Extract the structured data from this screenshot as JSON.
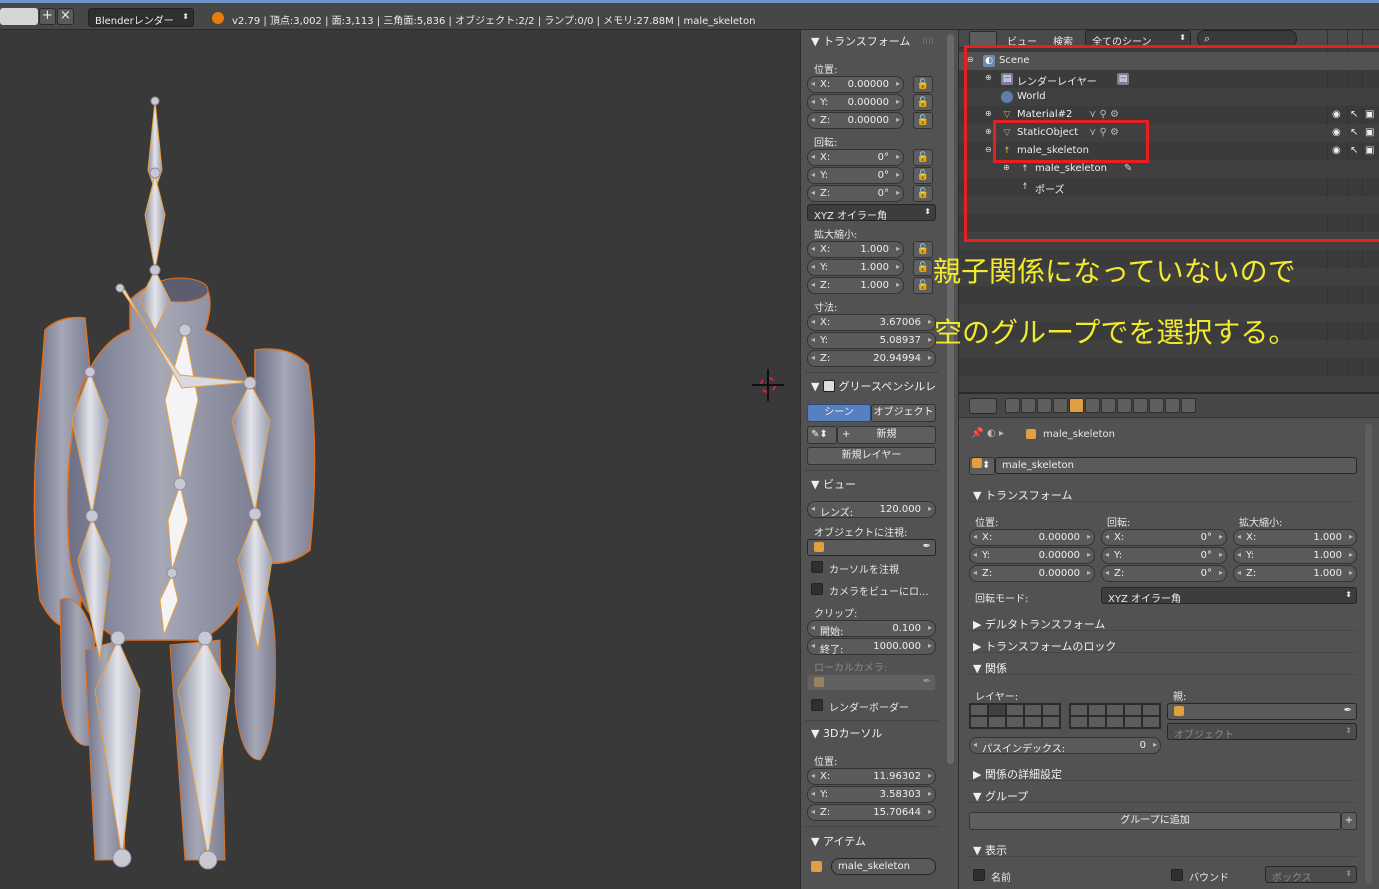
{
  "topbar": {
    "render_engine": "Blenderレンダー",
    "info": "v2.79 | 頂点:3,002 | 面:3,113 | 三角面:5,836 | オブジェクト:2/2 | ランプ:0/0 | メモリ:27.88M | male_skeleton"
  },
  "npanel": {
    "transform": {
      "title": "トランスフォーム",
      "location_label": "位置:",
      "location": [
        {
          "k": "X:",
          "v": "0.00000"
        },
        {
          "k": "Y:",
          "v": "0.00000"
        },
        {
          "k": "Z:",
          "v": "0.00000"
        }
      ],
      "rotation_label": "回転:",
      "rotation": [
        {
          "k": "X:",
          "v": "0°"
        },
        {
          "k": "Y:",
          "v": "0°"
        },
        {
          "k": "Z:",
          "v": "0°"
        }
      ],
      "rotation_mode": "XYZ オイラー角",
      "scale_label": "拡大縮小:",
      "scale": [
        {
          "k": "X:",
          "v": "1.000"
        },
        {
          "k": "Y:",
          "v": "1.000"
        },
        {
          "k": "Z:",
          "v": "1.000"
        }
      ],
      "dimensions_label": "寸法:",
      "dimensions": [
        {
          "k": "X:",
          "v": "3.67006"
        },
        {
          "k": "Y:",
          "v": "5.08937"
        },
        {
          "k": "Z:",
          "v": "20.94994"
        }
      ]
    },
    "grease": {
      "title": "グリースペンシルレ",
      "scene_tab": "シーン",
      "object_tab": "オブジェクト",
      "new_label": "新規",
      "new_layer": "新規レイヤー"
    },
    "view": {
      "title": "ビュー",
      "lens_k": "レンズ:",
      "lens_v": "120.000",
      "lock_to_object": "オブジェクトに注視:",
      "lock_cursor": "カーソルを注視",
      "lock_camera": "カメラをビューにロ...",
      "clip_label": "クリップ:",
      "clip_start_k": "開始:",
      "clip_start_v": "0.100",
      "clip_end_k": "終了:",
      "clip_end_v": "1000.000",
      "local_camera": "ローカルカメラ:",
      "render_border": "レンダーボーダー"
    },
    "cursor": {
      "title": "3Dカーソル",
      "location_label": "位置:",
      "location": [
        {
          "k": "X:",
          "v": "11.96302"
        },
        {
          "k": "Y:",
          "v": "3.58303"
        },
        {
          "k": "Z:",
          "v": "15.70644"
        }
      ]
    },
    "item": {
      "title": "アイテム",
      "name": "male_skeleton"
    }
  },
  "outliner": {
    "header": {
      "view": "ビュー",
      "search": "検索",
      "scope": "全てのシーン"
    },
    "rows": [
      "Scene",
      "レンダーレイヤー",
      "World",
      "Material#2",
      "StaticObject",
      "male_skeleton",
      "male_skeleton",
      "ポーズ"
    ]
  },
  "annotation": {
    "line1": "親子関係になっていないので",
    "line2": "空のグループでを選択する。"
  },
  "props": {
    "breadcrumb": "male_skeleton",
    "object_name": "male_skeleton",
    "transform": {
      "title": "トランスフォーム",
      "loc_label": "位置:",
      "rot_label": "回転:",
      "scale_label": "拡大縮小:",
      "loc": [
        {
          "k": "X:",
          "v": "0.00000"
        },
        {
          "k": "Y:",
          "v": "0.00000"
        },
        {
          "k": "Z:",
          "v": "0.00000"
        }
      ],
      "rot": [
        {
          "k": "X:",
          "v": "0°"
        },
        {
          "k": "Y:",
          "v": "0°"
        },
        {
          "k": "Z:",
          "v": "0°"
        }
      ],
      "scale": [
        {
          "k": "X:",
          "v": "1.000"
        },
        {
          "k": "Y:",
          "v": "1.000"
        },
        {
          "k": "Z:",
          "v": "1.000"
        }
      ],
      "rotmode_label": "回転モード:",
      "rotmode": "XYZ オイラー角"
    },
    "delta": "デルタトランスフォーム",
    "lock": "トランスフォームのロック",
    "relations": {
      "title": "関係",
      "layer_label": "レイヤー:",
      "parent_label": "親:",
      "parent_type": "オブジェクト",
      "pass_k": "パスインデックス:",
      "pass_v": "0"
    },
    "relations_extra": "関係の詳細設定",
    "groups": {
      "title": "グループ",
      "add": "グループに追加"
    },
    "display": {
      "title": "表示",
      "name": "名前",
      "bounds": "バウンド",
      "bounds_type": "ボックス"
    }
  }
}
